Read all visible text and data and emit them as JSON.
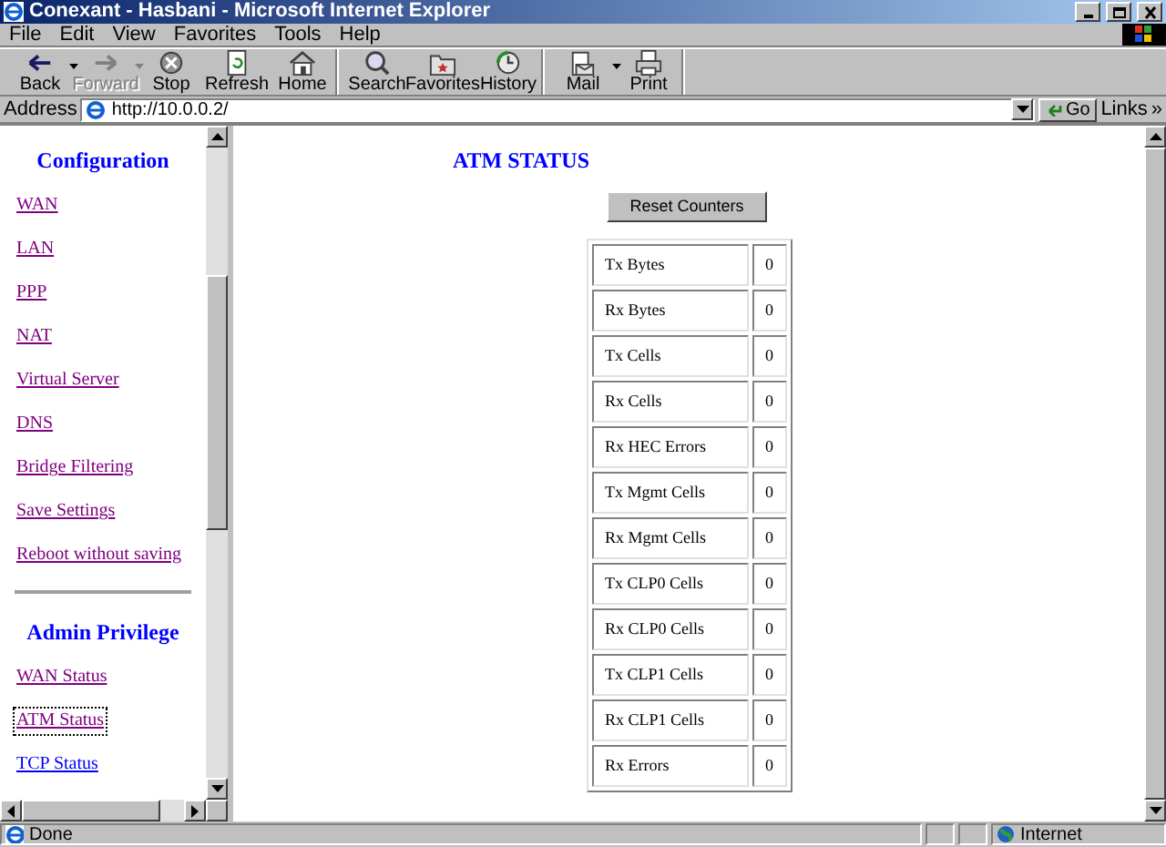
{
  "window": {
    "title": "Conexant - Hasbani - Microsoft Internet Explorer"
  },
  "menu": [
    "File",
    "Edit",
    "View",
    "Favorites",
    "Tools",
    "Help"
  ],
  "toolbar": [
    [
      {
        "kind": "back",
        "label": "Back",
        "disabled": false,
        "dropdown": true
      },
      {
        "kind": "forward",
        "label": "Forward",
        "disabled": true,
        "dropdown": true
      },
      {
        "kind": "stop",
        "label": "Stop",
        "disabled": false,
        "dropdown": false
      },
      {
        "kind": "refresh",
        "label": "Refresh",
        "disabled": false,
        "dropdown": false
      },
      {
        "kind": "home",
        "label": "Home",
        "disabled": false,
        "dropdown": false
      }
    ],
    [
      {
        "kind": "search",
        "label": "Search",
        "disabled": false,
        "dropdown": false
      },
      {
        "kind": "favorites",
        "label": "Favorites",
        "disabled": false,
        "dropdown": false
      },
      {
        "kind": "history",
        "label": "History",
        "disabled": false,
        "dropdown": false
      }
    ],
    [
      {
        "kind": "mail",
        "label": "Mail",
        "disabled": false,
        "dropdown": true
      },
      {
        "kind": "print",
        "label": "Print",
        "disabled": false,
        "dropdown": false
      }
    ]
  ],
  "address": {
    "label": "Address",
    "value": "http://10.0.0.2/",
    "go": "Go",
    "links": "Links",
    "more": "»"
  },
  "sidebar": {
    "sections": [
      {
        "title": "Configuration",
        "items": [
          {
            "label": "WAN",
            "visited": true,
            "focused": false
          },
          {
            "label": "LAN",
            "visited": true,
            "focused": false
          },
          {
            "label": "PPP",
            "visited": true,
            "focused": false
          },
          {
            "label": "NAT",
            "visited": true,
            "focused": false
          },
          {
            "label": "Virtual Server",
            "visited": true,
            "focused": false
          },
          {
            "label": "DNS",
            "visited": true,
            "focused": false
          },
          {
            "label": "Bridge Filtering",
            "visited": true,
            "focused": false
          },
          {
            "label": "Save Settings",
            "visited": true,
            "focused": false
          },
          {
            "label": "Reboot without saving",
            "visited": true,
            "focused": false
          }
        ]
      },
      {
        "title": "Admin Privilege",
        "items": [
          {
            "label": "WAN Status",
            "visited": true,
            "focused": false
          },
          {
            "label": "ATM Status",
            "visited": true,
            "focused": true
          },
          {
            "label": "TCP Status",
            "visited": false,
            "focused": false
          }
        ]
      }
    ]
  },
  "main": {
    "title": "ATM STATUS",
    "button": "Reset Counters",
    "rows": [
      {
        "label": "Tx Bytes",
        "value": "0"
      },
      {
        "label": "Rx Bytes",
        "value": "0"
      },
      {
        "label": "Tx Cells",
        "value": "0"
      },
      {
        "label": "Rx Cells",
        "value": "0"
      },
      {
        "label": "Rx HEC Errors",
        "value": "0"
      },
      {
        "label": "Tx Mgmt Cells",
        "value": "0"
      },
      {
        "label": "Rx Mgmt Cells",
        "value": "0"
      },
      {
        "label": "Tx CLP0 Cells",
        "value": "0"
      },
      {
        "label": "Rx CLP0 Cells",
        "value": "0"
      },
      {
        "label": "Tx CLP1 Cells",
        "value": "0"
      },
      {
        "label": "Rx CLP1 Cells",
        "value": "0"
      },
      {
        "label": "Rx Errors",
        "value": "0"
      }
    ]
  },
  "status_bar": {
    "text": "Done",
    "zone": "Internet"
  }
}
